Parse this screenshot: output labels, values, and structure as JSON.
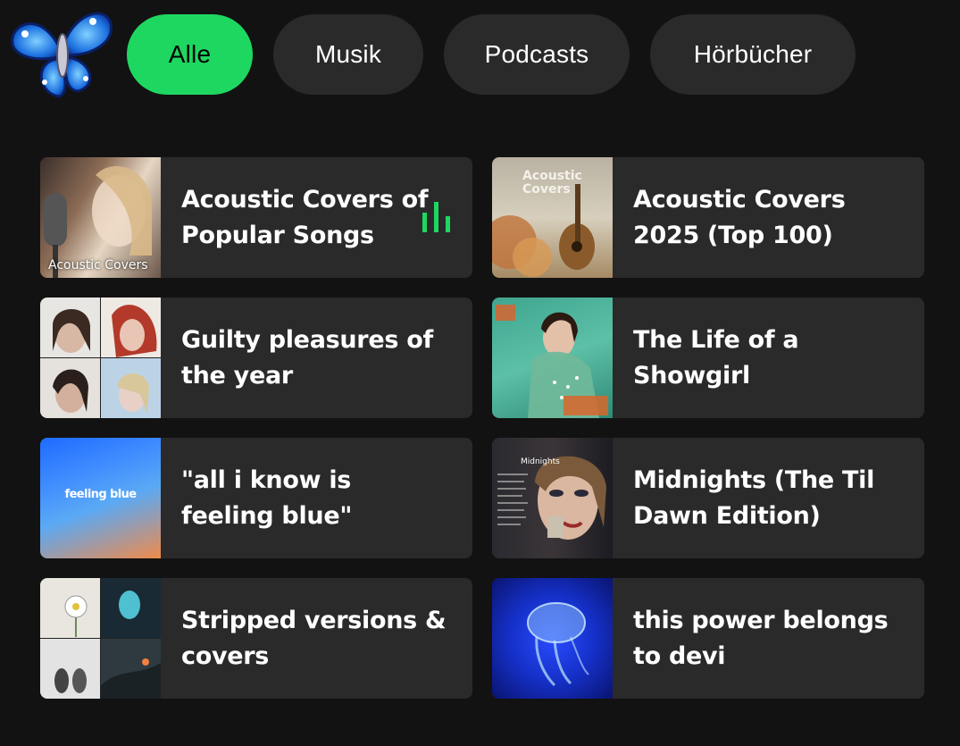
{
  "header": {
    "avatar_icon": "butterfly-icon",
    "filters": [
      {
        "label": "Alle",
        "active": true
      },
      {
        "label": "Musik",
        "active": false
      },
      {
        "label": "Podcasts",
        "active": false
      },
      {
        "label": "Hörbücher",
        "active": false
      }
    ]
  },
  "playlists": [
    {
      "title": "Acoustic Covers of Popular Songs",
      "cover_text": "Acoustic Covers",
      "playing": true,
      "playing_icon": "equalizer-bars-icon"
    },
    {
      "title": "Acoustic Covers 2025 (Top 100)",
      "cover_text": "Acoustic Covers"
    },
    {
      "title": "Guilty pleasures of the year"
    },
    {
      "title": "The Life of a Showgirl"
    },
    {
      "title": "\"all i know is feeling blue\"",
      "cover_text": "feeling blue"
    },
    {
      "title": "Midnights (The Til Dawn Edition)",
      "cover_text": "Midnights"
    },
    {
      "title": "Stripped versions & covers"
    },
    {
      "title": "this power belongs to devi"
    }
  ],
  "colors": {
    "background": "#121212",
    "card": "#2a2a2a",
    "chip": "#2a2a2a",
    "accent": "#1ed760"
  }
}
